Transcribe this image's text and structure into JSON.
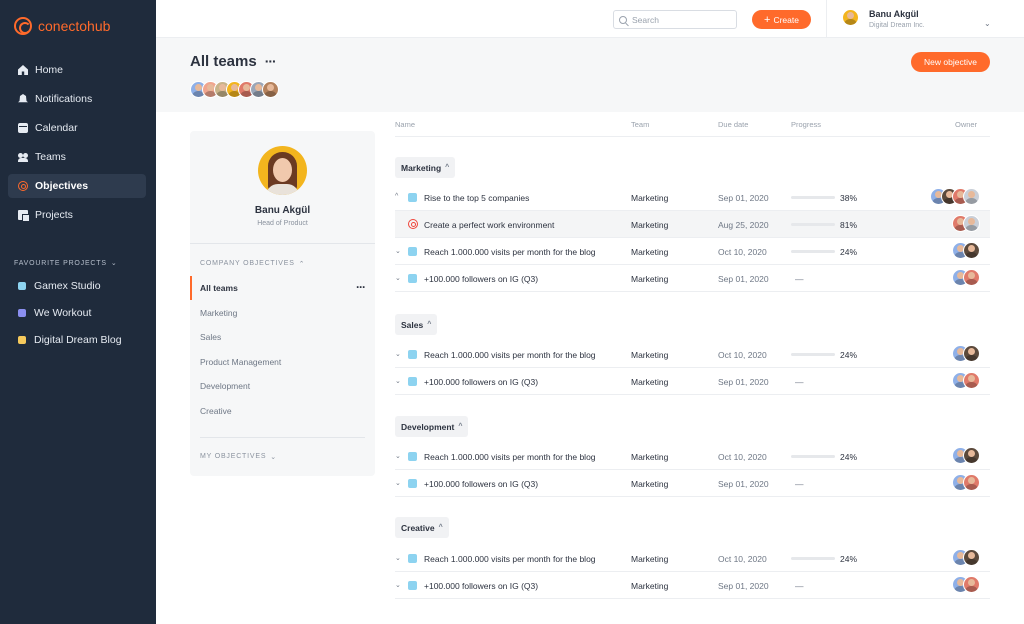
{
  "app": {
    "logo_text": "conectohub"
  },
  "sidebar": {
    "nav": [
      {
        "label": "Home",
        "icon": "home-icon"
      },
      {
        "label": "Notifications",
        "icon": "bell-icon"
      },
      {
        "label": "Calendar",
        "icon": "calendar-icon"
      },
      {
        "label": "Teams",
        "icon": "teams-icon"
      },
      {
        "label": "Objectives",
        "icon": "objectives-icon",
        "active": true
      },
      {
        "label": "Projects",
        "icon": "projects-icon"
      }
    ],
    "favourites_title": "FAVOURITE PROJECTS",
    "favourites": [
      {
        "label": "Gamex Studio",
        "color": "#8dd3f0"
      },
      {
        "label": "We Workout",
        "color": "#8b8ff0"
      },
      {
        "label": "Digital Dream Blog",
        "color": "#f5c95c"
      }
    ]
  },
  "topbar": {
    "search_placeholder": "Search",
    "create_label": "Create",
    "user_name": "Banu Akgül",
    "user_company": "Digital Dream Inc."
  },
  "header": {
    "title": "All teams",
    "more": "···",
    "new_objective_label": "New objective"
  },
  "profile": {
    "name": "Banu Akgül",
    "role": "Head of Product",
    "company_objectives_title": "COMPANY OBJECTIVES",
    "objectives": [
      "All teams",
      "Marketing",
      "Sales",
      "Product Management",
      "Development",
      "Creative"
    ],
    "my_objectives_title": "MY OBJECTIVES"
  },
  "table": {
    "columns": {
      "name": "Name",
      "team": "Team",
      "due": "Due date",
      "progress": "Progress",
      "owner": "Owner"
    },
    "groups": [
      {
        "label": "Marketing",
        "rows": [
          {
            "name": "Rise to the top 5 companies",
            "team": "Marketing",
            "due": "Sep 01, 2020",
            "progress": 38,
            "progress_label": "38%",
            "expanded": true
          },
          {
            "name": "Create a perfect work environment",
            "team": "Marketing",
            "due": "Aug 25, 2020",
            "progress": 81,
            "progress_label": "81%",
            "child": true
          },
          {
            "name": "Reach 1.000.000 visits per month for the blog",
            "team": "Marketing",
            "due": "Oct 10, 2020",
            "progress": 24,
            "progress_label": "24%"
          },
          {
            "name": "+100.000 followers on IG (Q3)",
            "team": "Marketing",
            "due": "Sep 01, 2020",
            "progress": null,
            "progress_label": "—"
          }
        ]
      },
      {
        "label": "Sales",
        "rows": [
          {
            "name": "Reach 1.000.000 visits per month for the blog",
            "team": "Marketing",
            "due": "Oct 10, 2020",
            "progress": 24,
            "progress_label": "24%"
          },
          {
            "name": "+100.000 followers on IG (Q3)",
            "team": "Marketing",
            "due": "Sep 01, 2020",
            "progress": null,
            "progress_label": "—"
          }
        ]
      },
      {
        "label": "Development",
        "rows": [
          {
            "name": "Reach 1.000.000 visits per month for the blog",
            "team": "Marketing",
            "due": "Oct 10, 2020",
            "progress": 24,
            "progress_label": "24%"
          },
          {
            "name": "+100.000 followers on IG (Q3)",
            "team": "Marketing",
            "due": "Sep 01, 2020",
            "progress": null,
            "progress_label": "—"
          }
        ]
      },
      {
        "label": "Creative",
        "rows": [
          {
            "name": "Reach 1.000.000 visits per month for the blog",
            "team": "Marketing",
            "due": "Oct 10, 2020",
            "progress": 24,
            "progress_label": "24%"
          },
          {
            "name": "+100.000 followers on IG (Q3)",
            "team": "Marketing",
            "due": "Sep 01, 2020",
            "progress": null,
            "progress_label": "—"
          }
        ]
      }
    ]
  },
  "colors": {
    "accent": "#ff6a2b",
    "sidebar_bg": "#1f2b3c",
    "progress": "#5dd36e",
    "objective_square": "#8dd3f0"
  }
}
